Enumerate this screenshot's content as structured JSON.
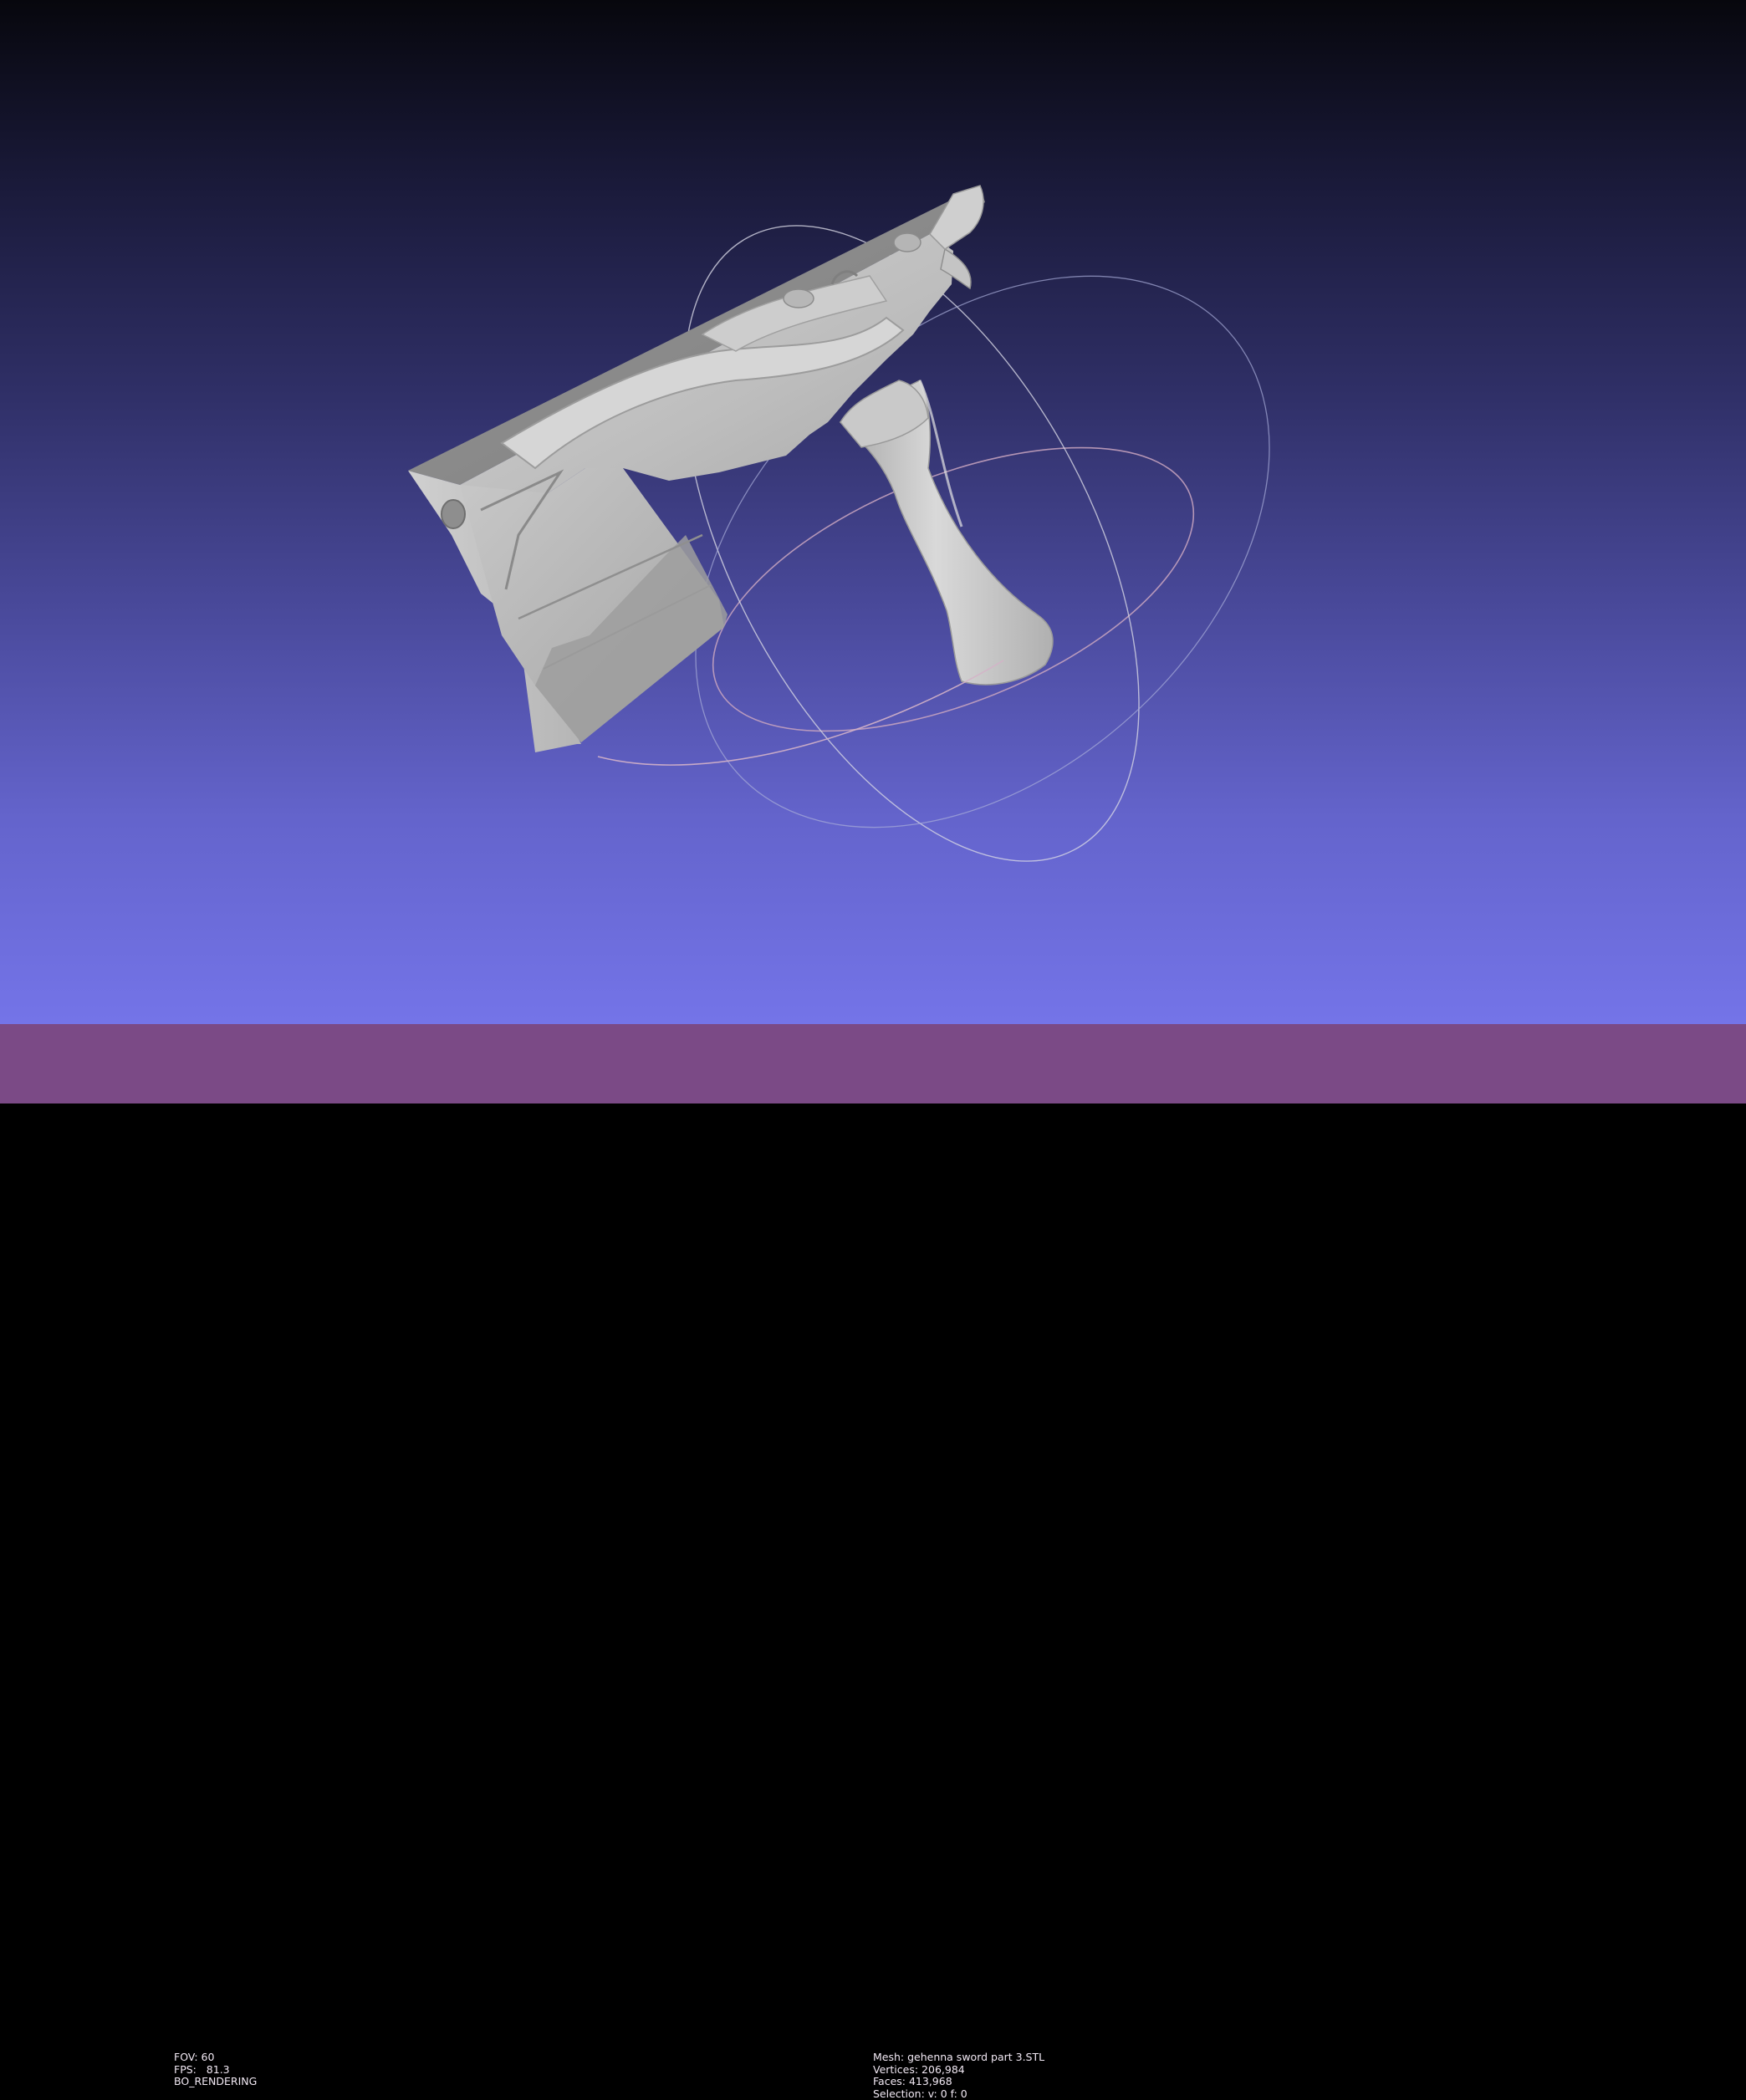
{
  "viewer": {
    "background_top": "#07070d",
    "background_bottom": "#7474e8",
    "mesh_color": "#c4c4c4",
    "trackball_colors": [
      "#d8d8d8",
      "#c8a0b8",
      "#a0a8d0"
    ]
  },
  "status_bar": {
    "color": "#7b4a86",
    "left": {
      "fov": "FOV: 60",
      "fps": "FPS:   81.3",
      "mode": "BO_RENDERING"
    },
    "right": {
      "mesh": "Mesh: gehenna sword part 3.STL",
      "vertices": "Vertices: 206,984",
      "faces": "Faces: 413,968",
      "selection": "Selection: v: 0 f: 0"
    }
  }
}
